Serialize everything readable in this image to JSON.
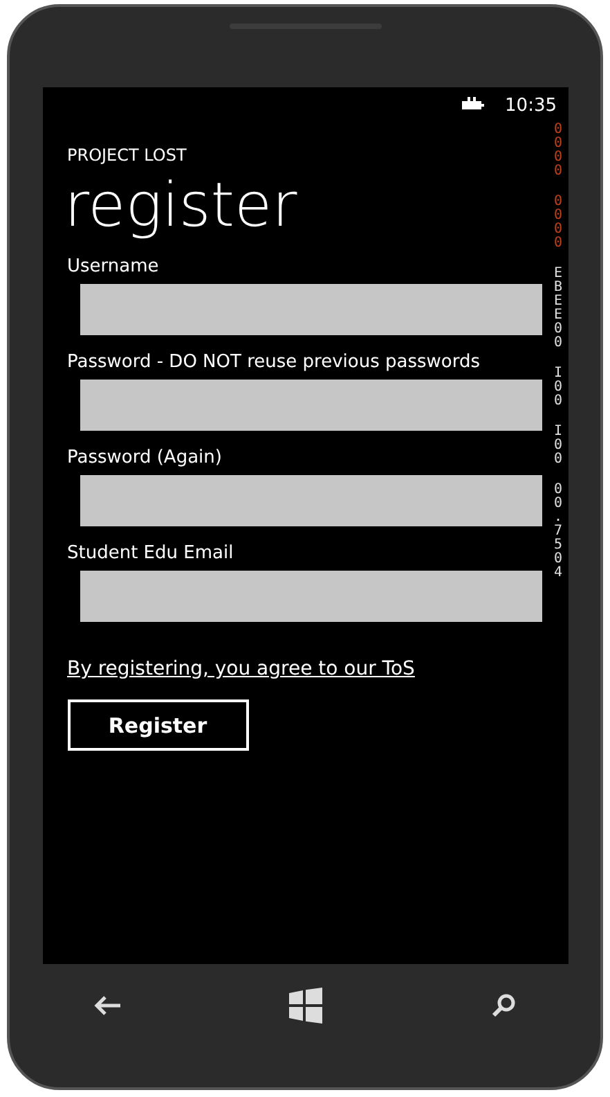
{
  "status_bar": {
    "time": "10:35"
  },
  "frame_counter": [
    {
      "text": "0000",
      "color": "#c0401a"
    },
    {
      "text": "0000",
      "color": "#c0401a"
    },
    {
      "text": "EBEE00",
      "color": "#e0e0e0"
    },
    {
      "text": "I 00",
      "color": "#e0e0e0"
    },
    {
      "text": "I 00",
      "color": "#e0e0e0"
    },
    {
      "text": "00 . 7504",
      "color": "#e0e0e0"
    }
  ],
  "app_title": "PROJECT LOST",
  "page_title": "register",
  "fields": [
    {
      "label": "Username"
    },
    {
      "label": "Password - DO NOT reuse previous passwords"
    },
    {
      "label": "Password (Again)"
    },
    {
      "label": "Student Edu Email"
    }
  ],
  "tos_link": "By registering, you agree to our ToS",
  "register_button": "Register"
}
